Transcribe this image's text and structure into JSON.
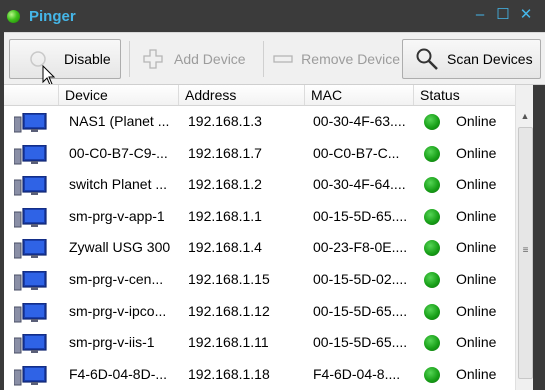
{
  "window": {
    "title": "Pinger",
    "minimize_glyph": "–",
    "maximize_glyph": "☐",
    "close_glyph": "✕"
  },
  "toolbar": {
    "disable_label": "Disable",
    "add_label": "Add Device",
    "remove_label": "Remove Device",
    "scan_label": "Scan Devices"
  },
  "table": {
    "columns": [
      "Device",
      "Address",
      "MAC",
      "Status"
    ],
    "rows": [
      {
        "device": "NAS1 (Planet ...",
        "address": "192.168.1.3",
        "mac": "00-30-4F-63....",
        "status": "Online"
      },
      {
        "device": "00-C0-B7-C9-...",
        "address": "192.168.1.7",
        "mac": "00-C0-B7-C...",
        "status": "Online"
      },
      {
        "device": "switch Planet ...",
        "address": "192.168.1.2",
        "mac": "00-30-4F-64....",
        "status": "Online"
      },
      {
        "device": "sm-prg-v-app-1",
        "address": "192.168.1.1",
        "mac": "00-15-5D-65....",
        "status": "Online"
      },
      {
        "device": "Zywall USG 300",
        "address": "192.168.1.4",
        "mac": "00-23-F8-0E....",
        "status": "Online"
      },
      {
        "device": "sm-prg-v-cen...",
        "address": "192.168.1.15",
        "mac": "00-15-5D-02....",
        "status": "Online"
      },
      {
        "device": "sm-prg-v-ipco...",
        "address": "192.168.1.12",
        "mac": "00-15-5D-65....",
        "status": "Online"
      },
      {
        "device": "sm-prg-v-iis-1",
        "address": "192.168.1.11",
        "mac": "00-15-5D-65....",
        "status": "Online"
      },
      {
        "device": "F4-6D-04-8D-...",
        "address": "192.168.1.18",
        "mac": "F4-6D-04-8....",
        "status": "Online"
      }
    ]
  },
  "colors": {
    "title": "#45b6e8",
    "status_online": "#19a119",
    "window_frame": "#3a3a3a"
  },
  "icons": {
    "device": "monitor-icon",
    "status": "status-dot-icon",
    "scan": "magnifier-icon"
  }
}
